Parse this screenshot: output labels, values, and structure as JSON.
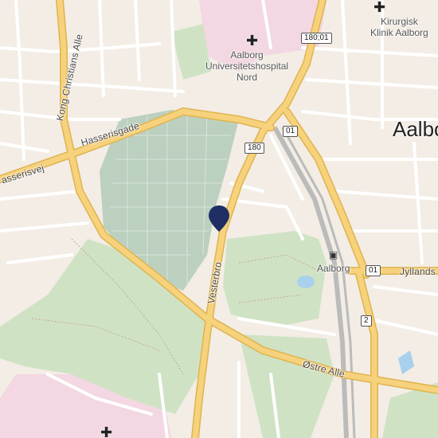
{
  "map": {
    "streets": {
      "kong_christians_alle": "Kong Christians Alle",
      "hasserisgade": "Hasserisgade",
      "hasserisvej": "asserisvej",
      "vesterbro": "Vesterbro",
      "ostre_alle": "Østre Alle",
      "jyllandsgade": "Jyllands"
    },
    "city": "Aalbor",
    "pois": {
      "hospital_nord": [
        "Aalborg",
        "Universitetshospital",
        "Nord"
      ],
      "kirurgisk_klinik": [
        "Kirurgisk",
        "Klinik Aalborg"
      ],
      "station": "Aalborg"
    },
    "route_shields": [
      "180;01",
      "01",
      "180",
      "01",
      "2"
    ],
    "icons": {
      "hospital": "hospital-cross-icon",
      "train": "train-station-icon",
      "pin": "location-pin-icon"
    },
    "colors": {
      "background": "#f3ede5",
      "park": "#cfe3c4",
      "cemetery": "#bcd0bf",
      "major_road": "#f6d27c",
      "major_road_casing": "#e0b350",
      "minor_road": "#ffffff",
      "hospital_area": "#f3d7e2",
      "pin": "#1f2f64",
      "water": "#a9d0ec"
    }
  }
}
